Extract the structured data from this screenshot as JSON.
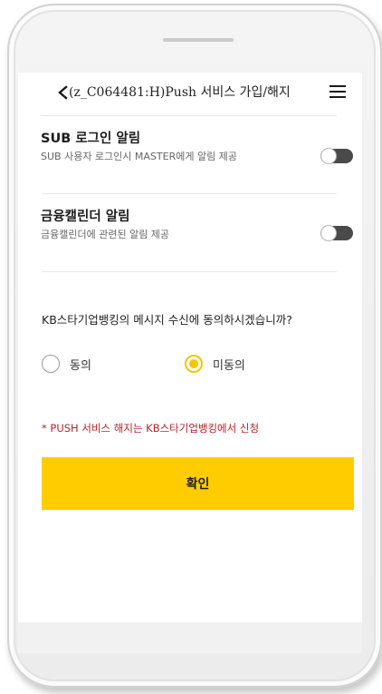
{
  "header": {
    "title": "(z_C064481:H)Push 서비스 가입/해지",
    "back_icon": "chevron-left-icon",
    "menu_icon": "hamburger-menu-icon"
  },
  "settings": [
    {
      "title": "SUB 로그인 알림",
      "description": "SUB 사용자 로그인시 MASTER에게 알림 제공",
      "enabled": false
    },
    {
      "title": "금융캘린더 알림",
      "description": "금융캘린더에 관련된 알림 제공",
      "enabled": false
    }
  ],
  "consent": {
    "question": "KB스타기업뱅킹의 메시지 수신에 동의하시겠습니까?",
    "options": [
      {
        "label": "동의",
        "selected": false
      },
      {
        "label": "미동의",
        "selected": true
      }
    ]
  },
  "notice": "* PUSH 서비스 해지는 KB스타기업뱅킹에서 신청",
  "confirm_label": "확인",
  "colors": {
    "accent": "#ffcc00",
    "radio_selected": "#f5c500",
    "notice": "#b5232d",
    "toggle_off_track": "#4a4a4a"
  }
}
